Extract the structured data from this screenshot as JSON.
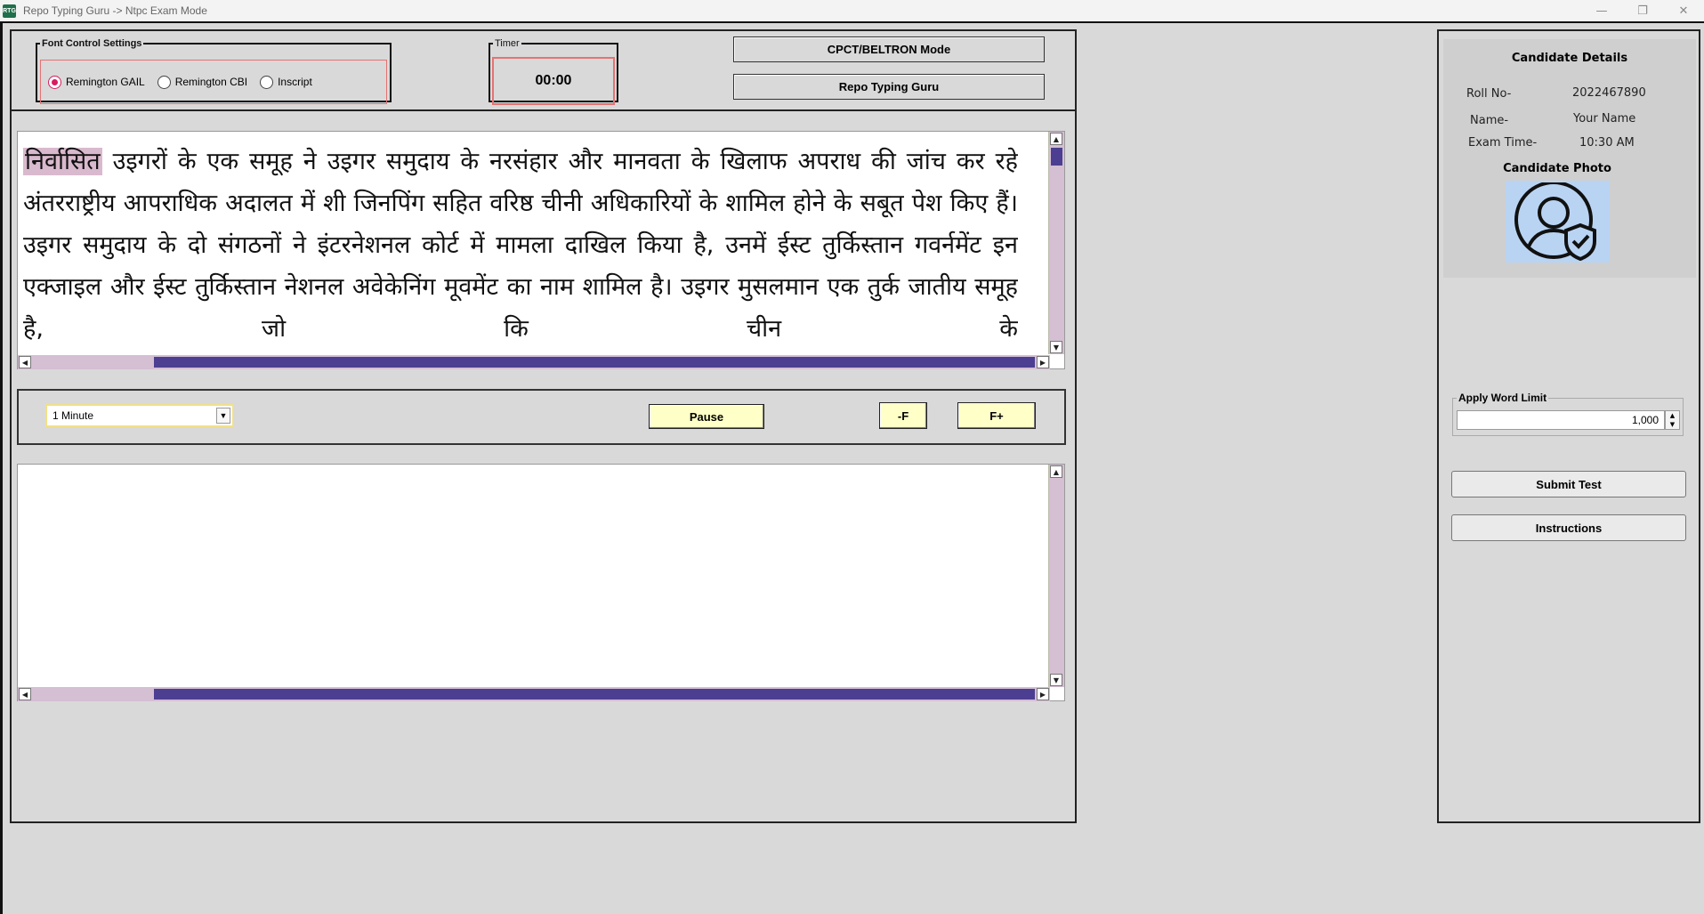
{
  "window": {
    "title": "Repo Typing Guru -> Ntpc Exam Mode",
    "icon_text": "RTG",
    "minimize": "—",
    "maximize": "❐",
    "close": "✕"
  },
  "font_settings": {
    "legend": "Font Control Settings",
    "options": [
      {
        "label": "Remington GAIL",
        "selected": true
      },
      {
        "label": "Remington CBI",
        "selected": false
      },
      {
        "label": "Inscript",
        "selected": false
      }
    ]
  },
  "timer": {
    "legend": "Timer",
    "value": "00:00"
  },
  "mode_buttons": {
    "cpct": "CPCT/BELTRON Mode",
    "repo": "Repo Typing Guru"
  },
  "passage": {
    "highlighted_word": "निर्वासित",
    "text": " उइगरों के एक समूह ने उइगर समुदाय के नरसंहार और मानवता के खिलाफ अपराध की जांच कर रहे अंतरराष्ट्रीय आपराधिक अदालत में शी जिनपिंग सहित वरिष्ठ चीनी अधिकारियों के शामिल होने के सबूत पेश किए हैं। उइगर समुदाय के दो संगठनों ने इंटरनेशनल कोर्ट में मामला दाखिल किया है, उनमें ईस्ट तुर्किस्तान गवर्नमेंट इन एक्जाइल और ईस्ट तुर्किस्तान नेशनल अवेकेनिंग मूवमेंट का नाम शामिल है। उइगर मुसलमान एक तुर्क जातीय समूह है, जो कि चीन के"
  },
  "controls": {
    "duration": "1 Minute",
    "pause": "Pause",
    "font_minus": "-F",
    "font_plus": "F+"
  },
  "typing_area": {
    "value": ""
  },
  "candidate": {
    "title": "Candidate Details",
    "roll_label": "Roll No-",
    "roll_value": "2022467890",
    "name_label": "Name-",
    "name_value": "Your Name",
    "time_label": "Exam Time-",
    "time_value": "10:30 AM",
    "photo_title": "Candidate Photo"
  },
  "word_limit": {
    "legend": "Apply Word Limit",
    "value": "1,000"
  },
  "side_buttons": {
    "submit": "Submit Test",
    "instructions": "Instructions"
  },
  "colors": {
    "scroll_track": "#d4bfd3",
    "scroll_thumb": "#4c3f91",
    "button_yellow": "#ffffc8",
    "radio_accent": "#d81b60",
    "highlight": "#d9b9cd"
  }
}
